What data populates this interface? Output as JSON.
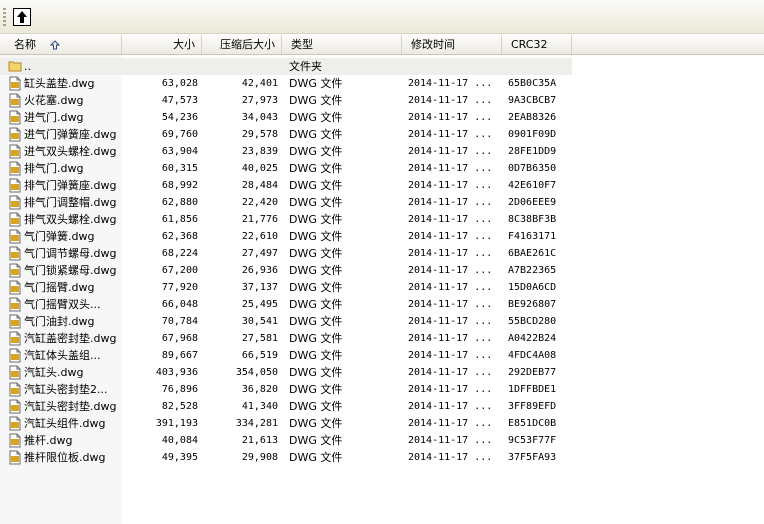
{
  "columns": {
    "name": "名称",
    "size": "大小",
    "compressed": "压缩后大小",
    "type": "类型",
    "modified": "修改时间",
    "crc": "CRC32"
  },
  "folder_row": {
    "name": "..",
    "type": "文件夹"
  },
  "files": [
    {
      "name": "缸头盖垫.dwg",
      "size": "63,028",
      "compressed": "42,401",
      "type": "DWG 文件",
      "modified": "2014-11-17 ...",
      "crc": "65B0C35A"
    },
    {
      "name": "火花塞.dwg",
      "size": "47,573",
      "compressed": "27,973",
      "type": "DWG 文件",
      "modified": "2014-11-17 ...",
      "crc": "9A3CBCB7"
    },
    {
      "name": "进气门.dwg",
      "size": "54,236",
      "compressed": "34,043",
      "type": "DWG 文件",
      "modified": "2014-11-17 ...",
      "crc": "2EAB8326"
    },
    {
      "name": "进气门弹簧座.dwg",
      "size": "69,760",
      "compressed": "29,578",
      "type": "DWG 文件",
      "modified": "2014-11-17 ...",
      "crc": "0901F09D"
    },
    {
      "name": "进气双头螺栓.dwg",
      "size": "63,904",
      "compressed": "23,839",
      "type": "DWG 文件",
      "modified": "2014-11-17 ...",
      "crc": "28FE1DD9"
    },
    {
      "name": "排气门.dwg",
      "size": "60,315",
      "compressed": "40,025",
      "type": "DWG 文件",
      "modified": "2014-11-17 ...",
      "crc": "0D7B6350"
    },
    {
      "name": "排气门弹簧座.dwg",
      "size": "68,992",
      "compressed": "28,484",
      "type": "DWG 文件",
      "modified": "2014-11-17 ...",
      "crc": "42E610F7"
    },
    {
      "name": "排气门调整帽.dwg",
      "size": "62,880",
      "compressed": "22,420",
      "type": "DWG 文件",
      "modified": "2014-11-17 ...",
      "crc": "2D06EEE9"
    },
    {
      "name": "排气双头螺栓.dwg",
      "size": "61,856",
      "compressed": "21,776",
      "type": "DWG 文件",
      "modified": "2014-11-17 ...",
      "crc": "8C38BF3B"
    },
    {
      "name": "气门弹簧.dwg",
      "size": "62,368",
      "compressed": "22,610",
      "type": "DWG 文件",
      "modified": "2014-11-17 ...",
      "crc": "F4163171"
    },
    {
      "name": "气门调节螺母.dwg",
      "size": "68,224",
      "compressed": "27,497",
      "type": "DWG 文件",
      "modified": "2014-11-17 ...",
      "crc": "6BAE261C"
    },
    {
      "name": "气门锁紧螺母.dwg",
      "size": "67,200",
      "compressed": "26,936",
      "type": "DWG 文件",
      "modified": "2014-11-17 ...",
      "crc": "A7B22365"
    },
    {
      "name": "气门摇臂.dwg",
      "size": "77,920",
      "compressed": "37,137",
      "type": "DWG 文件",
      "modified": "2014-11-17 ...",
      "crc": "15D0A6CD"
    },
    {
      "name": "气门摇臂双头...",
      "size": "66,048",
      "compressed": "25,495",
      "type": "DWG 文件",
      "modified": "2014-11-17 ...",
      "crc": "BE926807"
    },
    {
      "name": "气门油封.dwg",
      "size": "70,784",
      "compressed": "30,541",
      "type": "DWG 文件",
      "modified": "2014-11-17 ...",
      "crc": "55BCD280"
    },
    {
      "name": "汽缸盖密封垫.dwg",
      "size": "67,968",
      "compressed": "27,581",
      "type": "DWG 文件",
      "modified": "2014-11-17 ...",
      "crc": "A0422B24"
    },
    {
      "name": "汽缸体头盖组...",
      "size": "89,667",
      "compressed": "66,519",
      "type": "DWG 文件",
      "modified": "2014-11-17 ...",
      "crc": "4FDC4A08"
    },
    {
      "name": "汽缸头.dwg",
      "size": "403,936",
      "compressed": "354,050",
      "type": "DWG 文件",
      "modified": "2014-11-17 ...",
      "crc": "292DEB77"
    },
    {
      "name": "汽缸头密封垫2...",
      "size": "76,896",
      "compressed": "36,820",
      "type": "DWG 文件",
      "modified": "2014-11-17 ...",
      "crc": "1DFFBDE1"
    },
    {
      "name": "汽缸头密封垫.dwg",
      "size": "82,528",
      "compressed": "41,340",
      "type": "DWG 文件",
      "modified": "2014-11-17 ...",
      "crc": "3FF89EFD"
    },
    {
      "name": "汽缸头组件.dwg",
      "size": "391,193",
      "compressed": "334,281",
      "type": "DWG 文件",
      "modified": "2014-11-17 ...",
      "crc": "E851DC0B"
    },
    {
      "name": "推杆.dwg",
      "size": "40,084",
      "compressed": "21,613",
      "type": "DWG 文件",
      "modified": "2014-11-17 ...",
      "crc": "9C53F77F"
    },
    {
      "name": "推杆限位板.dwg",
      "size": "49,395",
      "compressed": "29,908",
      "type": "DWG 文件",
      "modified": "2014-11-17 ...",
      "crc": "37F5FA93"
    }
  ]
}
